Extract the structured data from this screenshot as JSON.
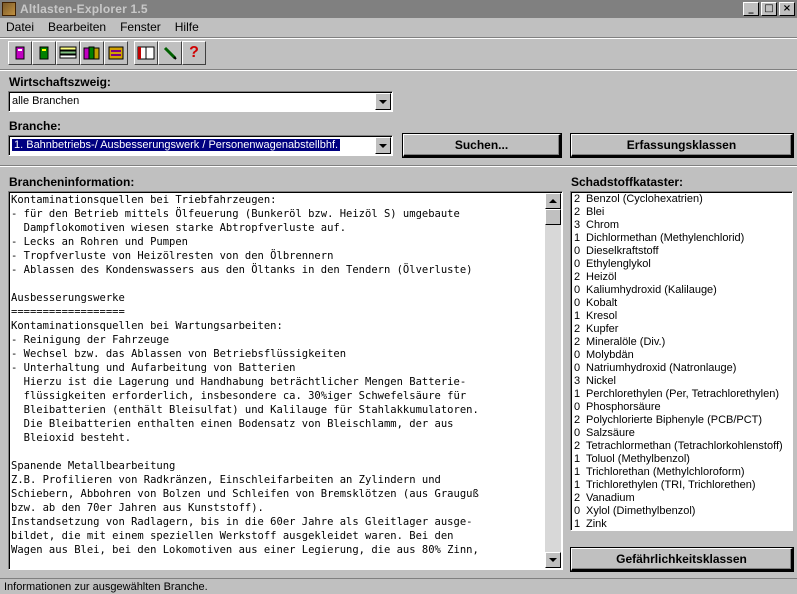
{
  "window": {
    "title": "Altlasten-Explorer  1.5"
  },
  "menu": [
    "Datei",
    "Bearbeiten",
    "Fenster",
    "Hilfe"
  ],
  "toolbar_icons": [
    "db-pink-icon",
    "db-green-icon",
    "list-stack-icon",
    "db-multi-icon",
    "db-gold-icon",
    "book-icon",
    "pen-icon",
    "help-icon"
  ],
  "wirtschaftszweig": {
    "label": "Wirtschaftszweig:",
    "value": "alle Branchen"
  },
  "branche": {
    "label": "Branche:",
    "value": "1. Bahnbetriebs-/ Ausbesserungswerk / Personenwagenabstellbhf."
  },
  "buttons": {
    "suchen": "Suchen...",
    "erfassungsklassen": "Erfassungsklassen",
    "gefaehrlichkeitsklassen": "Gefährlichkeitsklassen"
  },
  "brancheninfo": {
    "label": "Brancheninformation:",
    "lines": [
      "Kontaminationsquellen bei Triebfahrzeugen:",
      "- für den Betrieb mittels Ölfeuerung (Bunkeröl bzw. Heizöl S) umgebaute",
      "  Dampflokomotiven wiesen starke Abtropfverluste auf.",
      "- Lecks an Rohren und Pumpen",
      "- Tropfverluste von Heizölresten von den Ölbrennern",
      "- Ablassen des Kondenswassers aus den Öltanks in den Tendern (Ölverluste)",
      "",
      "Ausbesserungswerke",
      "==================",
      "Kontaminationsquellen bei Wartungsarbeiten:",
      "- Reinigung der Fahrzeuge",
      "- Wechsel bzw. das Ablassen von Betriebsflüssigkeiten",
      "- Unterhaltung und Aufarbeitung von Batterien",
      "  Hierzu ist die Lagerung und Handhabung beträchtlicher Mengen Batterie-",
      "  flüssigkeiten erforderlich, insbesondere ca. 30%iger Schwefelsäure für",
      "  Bleibatterien (enthält Bleisulfat) und Kalilauge für Stahlakkumulatoren.",
      "  Die Bleibatterien enthalten einen Bodensatz von Bleischlamm, der aus",
      "  Bleioxid besteht.",
      "",
      "Spanende Metallbearbeitung",
      "Z.B. Profilieren von Radkränzen, Einschleifarbeiten an Zylindern und",
      "Schiebern, Abbohren von Bolzen und Schleifen von Bremsklötzen (aus Grauguß",
      "bzw. ab den 70er Jahren aus Kunststoff).",
      "Instandsetzung von Radlagern, bis in die 60er Jahre als Gleitlager ausge-",
      "bildet, die mit einem speziellen Werkstoff ausgekleidet waren. Bei den",
      "Wagen aus Blei, bei den Lokomotiven aus einer Legierung, die aus 80% Zinn,"
    ]
  },
  "schadstoffkataster": {
    "label": "Schadstoffkataster:",
    "items": [
      {
        "n": "2",
        "name": "Benzol (Cyclohexatrien)"
      },
      {
        "n": "2",
        "name": "Blei"
      },
      {
        "n": "3",
        "name": "Chrom"
      },
      {
        "n": "1",
        "name": "Dichlormethan (Methylenchlorid)"
      },
      {
        "n": "0",
        "name": "Dieselkraftstoff"
      },
      {
        "n": "0",
        "name": "Ethylenglykol"
      },
      {
        "n": "2",
        "name": "Heizöl"
      },
      {
        "n": "0",
        "name": "Kaliumhydroxid (Kalilauge)"
      },
      {
        "n": "0",
        "name": "Kobalt"
      },
      {
        "n": "1",
        "name": "Kresol"
      },
      {
        "n": "2",
        "name": "Kupfer"
      },
      {
        "n": "2",
        "name": "Mineralöle (Div.)"
      },
      {
        "n": "0",
        "name": "Molybdän"
      },
      {
        "n": "0",
        "name": "Natriumhydroxid (Natronlauge)"
      },
      {
        "n": "3",
        "name": "Nickel"
      },
      {
        "n": "1",
        "name": "Perchlorethylen (Per, Tetrachlorethylen)"
      },
      {
        "n": "0",
        "name": "Phosphorsäure"
      },
      {
        "n": "2",
        "name": "Polychlorierte Biphenyle (PCB/PCT)"
      },
      {
        "n": "0",
        "name": "Salzsäure"
      },
      {
        "n": "2",
        "name": "Tetrachlormethan (Tetrachlorkohlenstoff)"
      },
      {
        "n": "1",
        "name": "Toluol (Methylbenzol)"
      },
      {
        "n": "1",
        "name": "Trichlorethan (Methylchloroform)"
      },
      {
        "n": "1",
        "name": "Trichlorethylen (TRI, Trichlorethen)"
      },
      {
        "n": "2",
        "name": "Vanadium"
      },
      {
        "n": "0",
        "name": "Xylol (Dimethylbenzol)"
      },
      {
        "n": "1",
        "name": "Zink"
      }
    ]
  },
  "status": "Informationen zur ausgewählten Branche."
}
